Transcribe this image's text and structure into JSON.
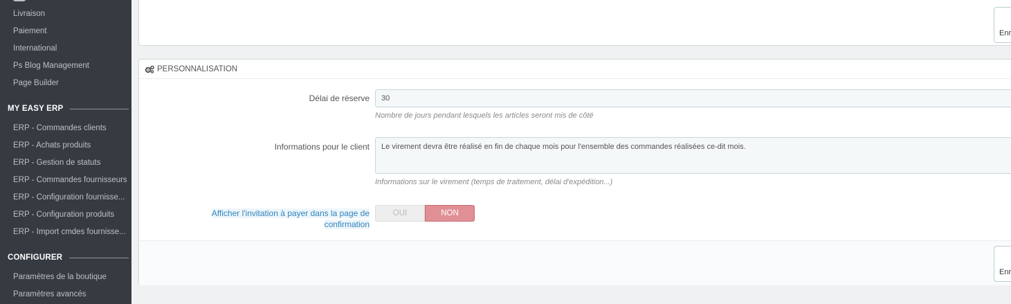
{
  "sidebar": {
    "items_top": [
      {
        "label": "Livraison"
      },
      {
        "label": "Paiement"
      },
      {
        "label": "International"
      },
      {
        "label": "Ps Blog Management"
      },
      {
        "label": "Page Builder"
      }
    ],
    "sections": [
      {
        "title": "MY EASY ERP",
        "items": [
          {
            "label": "ERP - Commandes clients"
          },
          {
            "label": "ERP - Achats produits"
          },
          {
            "label": "ERP - Gestion de statuts"
          },
          {
            "label": "ERP - Commandes fournisseurs"
          },
          {
            "label": "ERP - Configuration fournisse..."
          },
          {
            "label": "ERP - Configuration produits"
          },
          {
            "label": "ERP - Import cmdes fournisse..."
          }
        ]
      },
      {
        "title": "CONFIGURER",
        "items": [
          {
            "label": "Paramètres de la boutique"
          },
          {
            "label": "Paramètres avancés"
          }
        ]
      }
    ]
  },
  "top_panel": {
    "save_label": "Enregistrer"
  },
  "panel": {
    "title": "PERSONNALISATION",
    "reserve": {
      "label": "Délai de réserve",
      "value": "30",
      "help": "Nombre de jours pendant lesquels les articles seront mis de côté"
    },
    "client_info": {
      "label": "Informations pour le client",
      "value": "Le virement devra être réalisé en fin de chaque mois pour l'ensemble des commandes réalisées ce-dit mois.",
      "help": "Informations sur le virement (temps de traitement, délai d'expédition...)"
    },
    "invite": {
      "label_line1": "Afficher l'invitation à payer dans la page de",
      "label_line2": "confirmation",
      "yes": "OUI",
      "no": "NON",
      "selected": "NON"
    },
    "save_label": "Enregistrer"
  },
  "colors": {
    "sidebar_bg": "#363a41",
    "page_bg": "#eff1f2",
    "toggle_no": "#e08f95",
    "link": "#3183bb"
  }
}
